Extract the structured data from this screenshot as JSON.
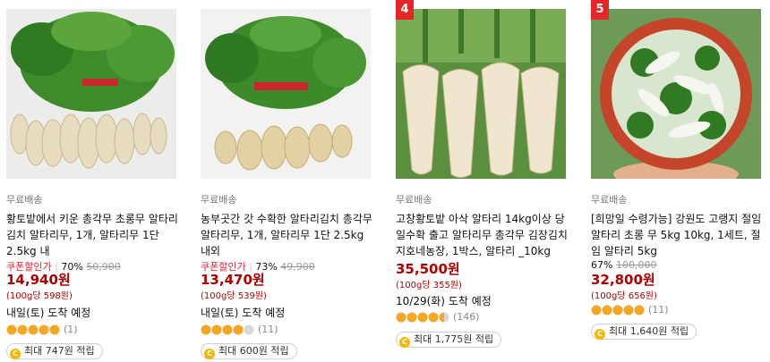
{
  "colors": {
    "rank_badge": "#e52528",
    "price": "#ae0000",
    "coupon": "#e8192c",
    "star": "#f5a623"
  },
  "products": [
    {
      "shipping": "무료배송",
      "title": "황토밭에서 키운 총각무 초롱무 알타리김치 알타리무, 1개, 알타리무 1단 2.5kg 내",
      "discount": {
        "coupon_label": "쿠폰할인가",
        "percent": "70%",
        "original": "50,900"
      },
      "price": "14,940원",
      "unit_price": "(100g당 598원)",
      "delivery": "내일(토) 도착 예정",
      "rating": {
        "stars": 5,
        "count": "(1)"
      },
      "reward": "최대 747원 적립"
    },
    {
      "shipping": "무료배송",
      "title": "농부곳간 갓 수확한 알타리김치 총각무 알타리무, 1개, 알타리무 1단 2.5kg 내외",
      "discount": {
        "coupon_label": "쿠폰할인가",
        "percent": "73%",
        "original": "49,900"
      },
      "price": "13,470원",
      "unit_price": "(100g당 539원)",
      "delivery": "내일(토) 도착 예정",
      "rating": {
        "stars": 4,
        "count": "(11)"
      },
      "reward": "최대 600원 적립"
    },
    {
      "rank": "4",
      "shipping": "무료배송",
      "title": "고창황토밭 아삭 알타리 14kg이상 당일수확 출고 알타리무 총각무 김장김치 지호네농장, 1박스, 알타리 _10kg",
      "price": "35,500원",
      "unit_price": "(100g당 355원)",
      "delivery": "10/29(화) 도착 예정",
      "rating": {
        "stars": 4.5,
        "count": "(146)"
      },
      "reward": "최대 1,775원 적립"
    },
    {
      "rank": "5",
      "shipping": "무료배송",
      "title": "[희망일 수령가능] 강원도 고랭지 절임 알타리 초롱 무 5kg 10kg, 1세트, 절임 알타리 5kg",
      "discount": {
        "percent": "67%",
        "original": "100,000"
      },
      "price": "32,800원",
      "unit_price": "(100g당 656원)",
      "rating": {
        "stars": 5,
        "count": "(11)"
      },
      "reward": "최대 1,640원 적립"
    }
  ]
}
